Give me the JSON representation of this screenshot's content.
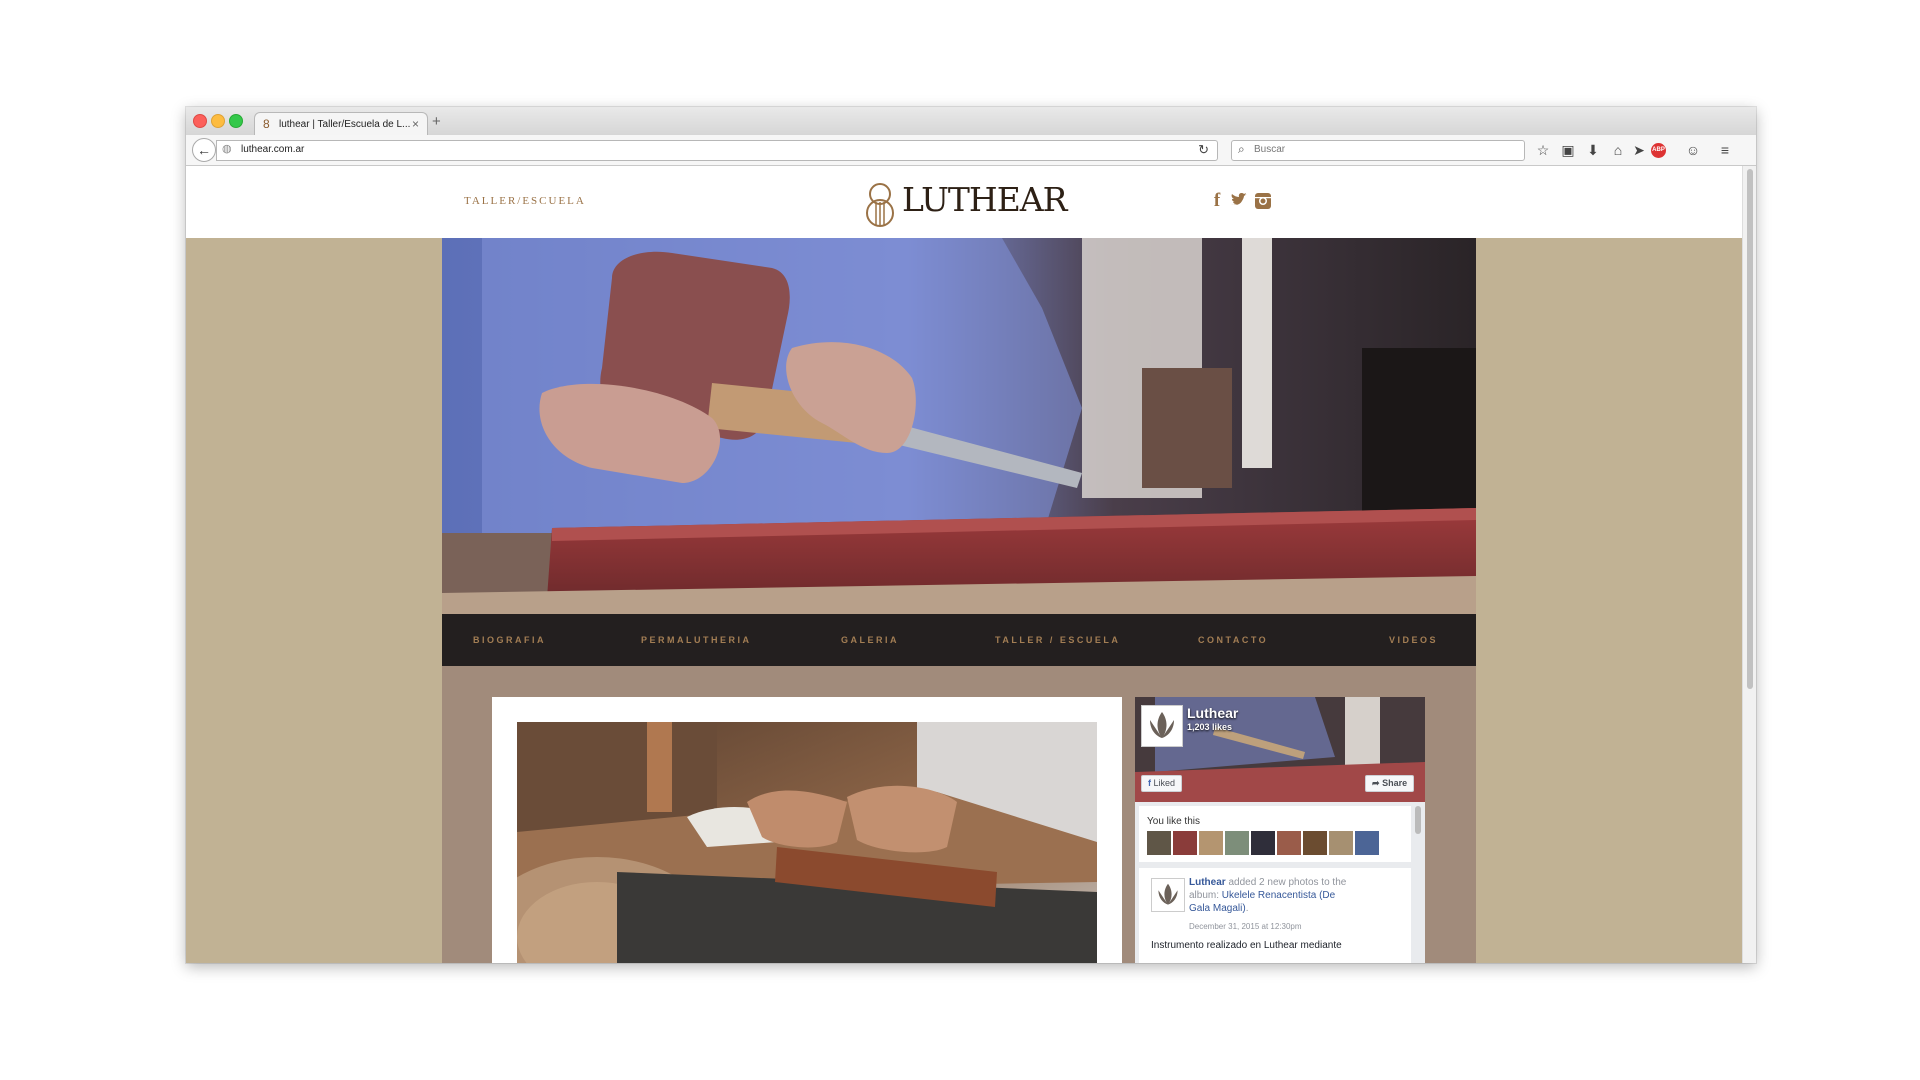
{
  "browser": {
    "tab_title": "luthear | Taller/Escuela de L...",
    "tab_close": "×",
    "new_tab": "+",
    "url": "luthear.com.ar",
    "search_placeholder": "Buscar",
    "toolbar_icons": [
      "bookmark-star-icon",
      "clipboard-icon",
      "download-icon",
      "home-icon",
      "send-icon",
      "adblock-icon",
      "chat-icon",
      "menu-icon"
    ],
    "adblock_label": "ABP"
  },
  "site": {
    "header_link": "TALLER/ESCUELA",
    "logo_text": "LUTHEAR",
    "social": [
      "f",
      "t",
      "ig"
    ],
    "accent_color": "#9a7246",
    "background_color": "#c1b294"
  },
  "menu": {
    "items": [
      "BIOGRAFIA",
      "PERMALUTHERIA",
      "GALERIA",
      "TALLER / ESCUELA",
      "CONTACTO",
      "VIDEOS"
    ]
  },
  "facebook": {
    "page_name": "Luthear",
    "likes": "1,203 likes",
    "liked_label": "Liked",
    "share_label": "Share",
    "you_like_this": "You like this",
    "post": {
      "author": "Luthear",
      "action": " added 2 new photos to the",
      "album_prefix": "album: ",
      "album_part1": "Ukelele Renacentista (De",
      "album_part2": "Gala Magali)",
      "album_end": ".",
      "date": "December 31, 2015 at 12:30pm",
      "body": "Instrumento realizado en Luthear mediante"
    }
  }
}
